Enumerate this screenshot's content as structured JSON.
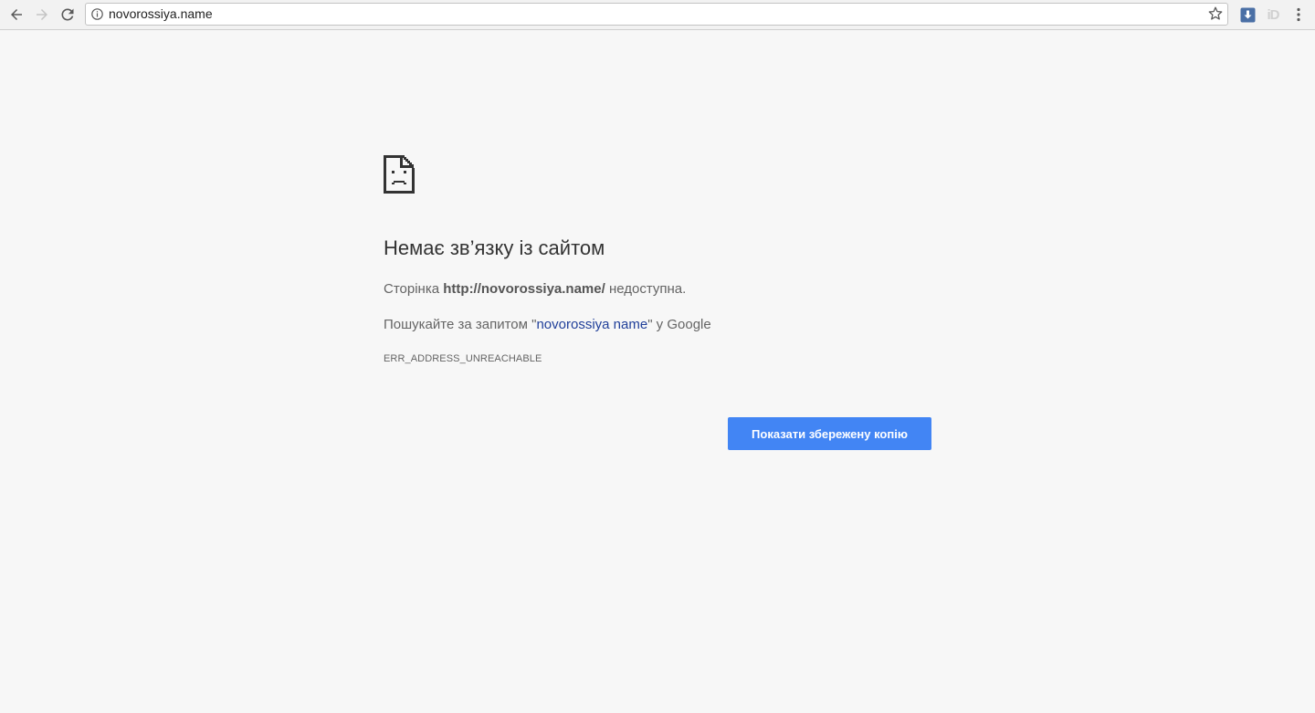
{
  "toolbar": {
    "back_icon": "arrow-left-icon",
    "forward_icon": "arrow-right-icon",
    "reload_icon": "reload-icon",
    "menu_icon": "more-vert-icon"
  },
  "omnibox": {
    "url": "novorossiya.name",
    "info_icon": "info-icon",
    "star_icon": "star-icon"
  },
  "extensions": [
    {
      "name": "download-extension-icon"
    },
    {
      "name": "id-extension-icon",
      "label": "iD"
    }
  ],
  "error_page": {
    "icon": "sad-page-icon",
    "title": "Немає зв’язку із сайтом",
    "line1_prefix": "Сторінка ",
    "line1_url": "http://novorossiya.name/",
    "line1_suffix": " недоступна.",
    "line2_prefix": "Пошукайте за запитом \"",
    "line2_query": "novorossiya name",
    "line2_suffix": "\" у Google",
    "error_code": "ERR_ADDRESS_UNREACHABLE",
    "button_label": "Показати збережену копію"
  },
  "colors": {
    "background": "#f7f7f7",
    "button": "#4285f4",
    "link": "#21409a",
    "text": "#646464",
    "title": "#333333"
  }
}
